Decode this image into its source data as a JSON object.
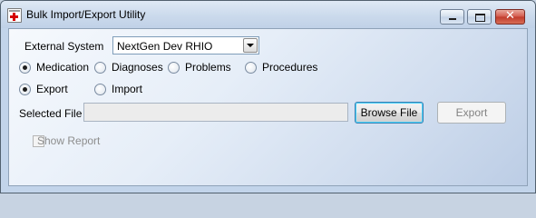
{
  "window": {
    "title": "Bulk Import/Export Utility",
    "controls": {
      "minimize_icon": "minimize-icon",
      "maximize_icon": "maximize-icon",
      "close_glyph": "✕"
    }
  },
  "form": {
    "external_system": {
      "label": "External System",
      "selected_value": "NextGen Dev RHIO"
    },
    "data_type_options": [
      {
        "label": "Medication",
        "checked": true
      },
      {
        "label": "Diagnoses",
        "checked": false
      },
      {
        "label": "Problems",
        "checked": false
      },
      {
        "label": "Procedures",
        "checked": false
      }
    ],
    "direction_options": [
      {
        "label": "Export",
        "checked": true
      },
      {
        "label": "Import",
        "checked": false
      }
    ],
    "selected_file": {
      "label": "Selected File",
      "value": ""
    },
    "buttons": {
      "browse_label": "Browse File",
      "export_label": "Export"
    },
    "show_report": {
      "label": "Show Report",
      "checked": false
    }
  },
  "colors": {
    "client_gradient_start": "#f6f9fd",
    "client_gradient_end": "#bccde5",
    "close_button": "#c03a2b",
    "focus_border": "#3c7fb1"
  }
}
